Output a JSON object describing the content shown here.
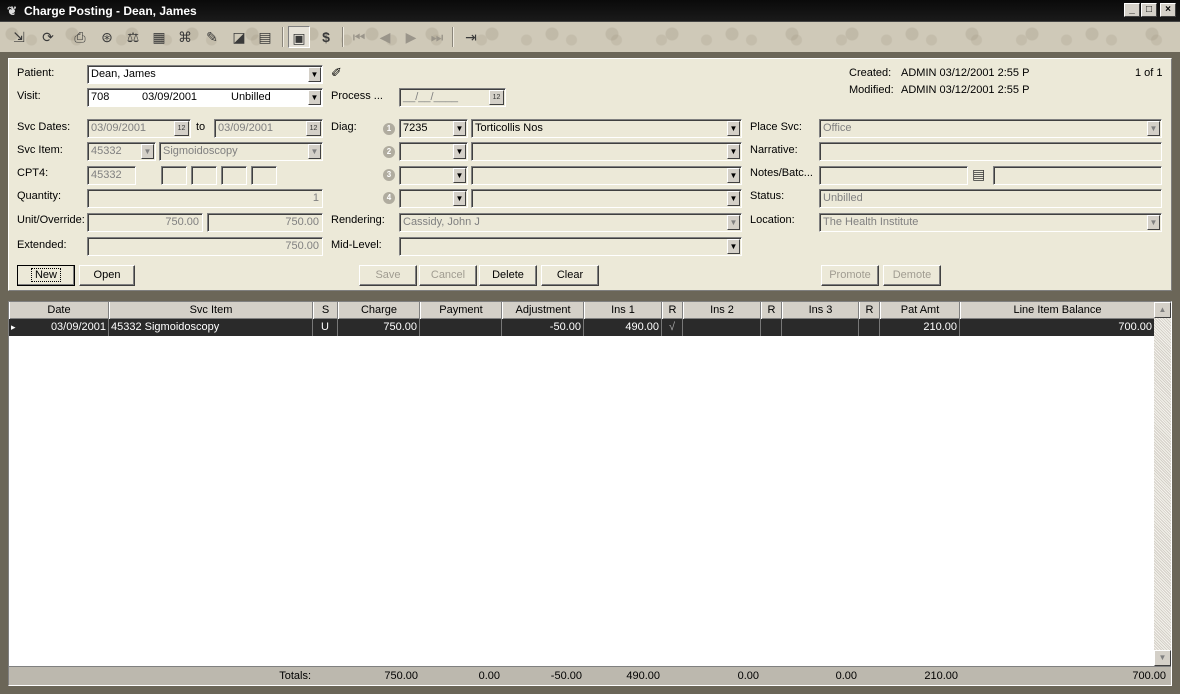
{
  "window": {
    "title": "Charge Posting - Dean, James",
    "controls": {
      "minimize": "_",
      "maximize": "□",
      "close": "×"
    }
  },
  "toolbar": {
    "buttons": [
      {
        "name": "post-icon",
        "glyph": "⇲"
      },
      {
        "name": "refresh-icon",
        "glyph": "⟳"
      },
      {
        "name": "print-icon",
        "glyph": "⎙"
      },
      {
        "name": "lookup-icon",
        "glyph": "⊛"
      },
      {
        "name": "balance-scale-icon",
        "glyph": "⚖"
      },
      {
        "name": "hospital-icon",
        "glyph": "▦"
      },
      {
        "name": "insurance-icon",
        "glyph": "⌘"
      },
      {
        "name": "pen-icon",
        "glyph": "✎"
      },
      {
        "name": "eraser-icon",
        "glyph": "◪"
      },
      {
        "name": "report-icon",
        "glyph": "▤"
      },
      {
        "name": "charge-posting-icon",
        "glyph": "▣"
      },
      {
        "name": "payment-icon",
        "glyph": "$"
      },
      {
        "name": "first-record-icon",
        "glyph": "⏮"
      },
      {
        "name": "previous-record-icon",
        "glyph": "◀"
      },
      {
        "name": "next-record-icon",
        "glyph": "▶"
      },
      {
        "name": "last-record-icon",
        "glyph": "⏭"
      },
      {
        "name": "exit-icon",
        "glyph": "⇥"
      }
    ]
  },
  "form": {
    "patient_label": "Patient:",
    "patient_value": "Dean, James",
    "visit_label": "Visit:",
    "visit_number": "708",
    "visit_date": "03/09/2001",
    "visit_status": "Unbilled",
    "process_label": "Process ...",
    "process_value": "__/__/____",
    "created_label": "Created:",
    "created_value": "ADMIN 03/12/2001 2:55 P",
    "modified_label": "Modified:",
    "modified_value": "ADMIN 03/12/2001 2:55 P",
    "record_position": "1 of 1",
    "svc_dates_label": "Svc Dates:",
    "svc_date_from": "03/09/2001",
    "svc_dates_to_label": "to",
    "svc_date_to": "03/09/2001",
    "svc_item_label": "Svc Item:",
    "svc_item_code": "45332",
    "svc_item_desc": "Sigmoidoscopy",
    "cpt4_label": "CPT4:",
    "cpt4_value": "45332",
    "quantity_label": "Quantity:",
    "quantity_value": "1",
    "unit_override_label": "Unit/Override:",
    "unit_value": "750.00",
    "override_value": "750.00",
    "extended_label": "Extended:",
    "extended_value": "750.00",
    "diag_label": "Diag:",
    "diag_nums": [
      "1",
      "2",
      "3",
      "4"
    ],
    "diag1_code": "7235",
    "diag1_desc": "Torticollis Nos",
    "rendering_label": "Rendering:",
    "rendering_value": "Cassidy, John J",
    "midlevel_label": "Mid-Level:",
    "place_svc_label": "Place Svc:",
    "place_svc_value": "Office",
    "narrative_label": "Narrative:",
    "notes_label": "Notes/Batc...",
    "status_label": "Status:",
    "status_value": "Unbilled",
    "location_label": "Location:",
    "location_value": "The Health Institute"
  },
  "buttons": {
    "new": "New",
    "open": "Open",
    "save": "Save",
    "cancel": "Cancel",
    "delete": "Delete",
    "clear": "Clear",
    "promote": "Promote",
    "demote": "Demote"
  },
  "grid": {
    "columns": [
      "Date",
      "Svc Item",
      "S",
      "Charge",
      "Payment",
      "Adjustment",
      "Ins 1",
      "R",
      "Ins 2",
      "R",
      "Ins 3",
      "R",
      "Pat Amt",
      "Line Item Balance"
    ],
    "rows": [
      {
        "indicator": "▸",
        "date": "03/09/2001",
        "svc_item": "45332 Sigmoidoscopy",
        "s": "U",
        "charge": "750.00",
        "payment": "",
        "adjustment": "-50.00",
        "ins1": "490.00",
        "r1": "√",
        "ins2": "",
        "r2": "",
        "ins3": "",
        "r3": "",
        "pat_amt": "210.00",
        "balance": "700.00"
      }
    ],
    "totals": {
      "label": "Totals:",
      "charge": "750.00",
      "payment": "0.00",
      "adjustment": "-50.00",
      "ins1": "490.00",
      "ins2": "0.00",
      "ins3": "0.00",
      "pat_amt": "210.00",
      "balance": "700.00"
    }
  }
}
